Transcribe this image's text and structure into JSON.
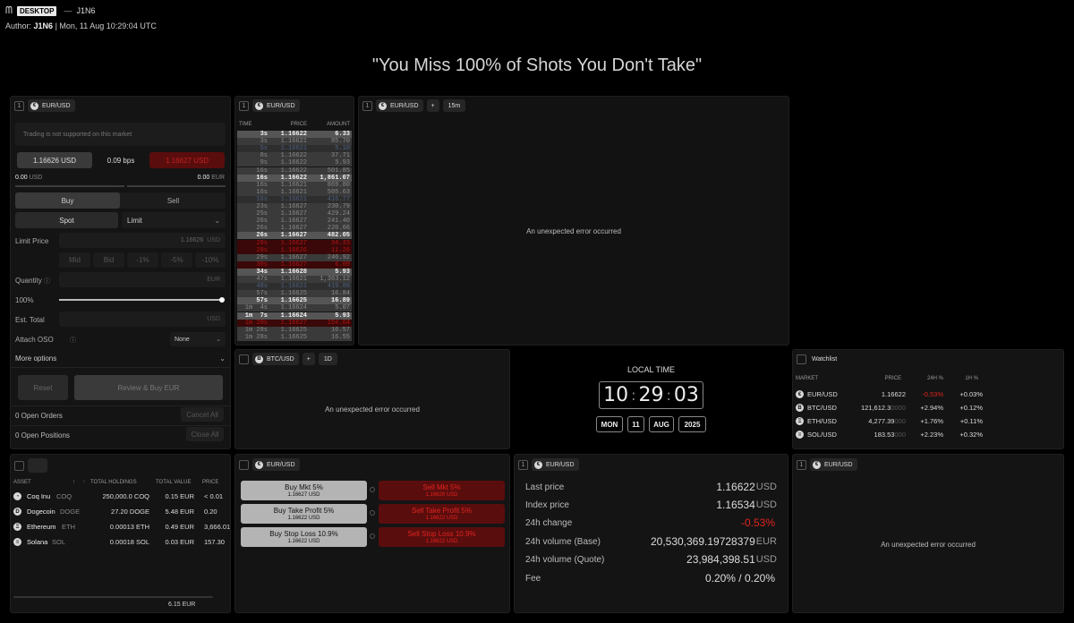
{
  "header": {
    "logo_text": "DESKTOP",
    "dash": "—",
    "title": "J1N6",
    "author_label": "Author:",
    "author": "J1N6",
    "date": "| Mon, 11 Aug 10:29:04 UTC",
    "quote": "\"You Miss 100% of Shots You Don't Take\""
  },
  "trade": {
    "num": "1",
    "market": "EUR/USD",
    "notice": "Trading is not supported on this market",
    "bid": "1.16626 USD",
    "spread": "0.09 bps",
    "ask": "1.16627 USD",
    "bal_left_val": "0.00",
    "bal_left_unit": "USD",
    "bal_right_val": "0.00",
    "bal_right_unit": "EUR",
    "buy": "Buy",
    "sell": "Sell",
    "spot": "Spot",
    "order_type": "Limit",
    "limit_price_label": "Limit Price",
    "limit_price_val": "1.16626",
    "limit_price_unit": "USD",
    "q_mid": "Mid",
    "q_bid": "Bid",
    "q_1": "-1%",
    "q_5": "-5%",
    "q_10": "-10%",
    "qty_label": "Quantity",
    "qty_unit": "EUR",
    "pct_label": "100%",
    "slider_pct": 100,
    "est_label": "Est. Total",
    "est_unit": "USD",
    "oso_label": "Attach OSO",
    "oso_val": "None",
    "more": "More options",
    "reset": "Reset",
    "review": "Review & Buy EUR",
    "open_orders": "0 Open Orders",
    "cancel_all": "Cancel All",
    "open_positions": "0 Open Positions",
    "close_all": "Close All"
  },
  "trades": {
    "num": "1",
    "market": "EUR/USD",
    "h_time": "TIME",
    "h_price": "PRICE",
    "h_amount": "AMOUNT",
    "rows": [
      {
        "t": "3s",
        "p": "1.16622",
        "a": "6.33",
        "c": "w"
      },
      {
        "t": "3s",
        "p": "1.16621",
        "a": "85.70",
        "c": "g"
      },
      {
        "t": "5s",
        "p": "1.16621",
        "a": "5.10",
        "c": "b"
      },
      {
        "t": "8s",
        "p": "1.16622",
        "a": "37.71",
        "c": "g"
      },
      {
        "t": "9s",
        "p": "1.16622",
        "a": "5.93",
        "c": "g"
      },
      {
        "t": "16s",
        "p": "1.16622",
        "a": "501.85",
        "c": "g"
      },
      {
        "t": "16s",
        "p": "1.16622",
        "a": "1,861.07",
        "c": "w"
      },
      {
        "t": "16s",
        "p": "1.16621",
        "a": "869.80",
        "c": "g"
      },
      {
        "t": "16s",
        "p": "1.16621",
        "a": "505.63",
        "c": "g"
      },
      {
        "t": "16s",
        "p": "1.16621",
        "a": "416.77",
        "c": "b"
      },
      {
        "t": "23s",
        "p": "1.16627",
        "a": "230.79",
        "c": "g"
      },
      {
        "t": "25s",
        "p": "1.16627",
        "a": "429.24",
        "c": "g"
      },
      {
        "t": "26s",
        "p": "1.16627",
        "a": "241.40",
        "c": "g"
      },
      {
        "t": "26s",
        "p": "1.16627",
        "a": "220.66",
        "c": "g"
      },
      {
        "t": "26s",
        "p": "1.16627",
        "a": "482.05",
        "c": "w"
      },
      {
        "t": "28s",
        "p": "1.16627",
        "a": "34.33",
        "c": "r"
      },
      {
        "t": "28s",
        "p": "1.16626",
        "a": "11.26",
        "c": "r"
      },
      {
        "t": "29s",
        "p": "1.16627",
        "a": "246.92",
        "c": "g"
      },
      {
        "t": "30s",
        "p": "1.16627",
        "a": "6.09",
        "c": "r"
      },
      {
        "t": "34s",
        "p": "1.16628",
        "a": "5.93",
        "c": "w"
      },
      {
        "t": "47s",
        "p": "1.16621",
        "a": "1,363.12",
        "c": "g"
      },
      {
        "t": "48s",
        "p": "1.16621",
        "a": "419.88",
        "c": "b"
      },
      {
        "t": "57s",
        "p": "1.16625",
        "a": "16.84",
        "c": "g"
      },
      {
        "t": "57s",
        "p": "1.16625",
        "a": "16.89",
        "c": "w"
      },
      {
        "t": "1m  4s",
        "p": "1.16624",
        "a": "5.07",
        "c": "g"
      },
      {
        "t": "1m  7s",
        "p": "1.16624",
        "a": "5.93",
        "c": "w"
      },
      {
        "t": "1m 20s",
        "p": "1.16627",
        "a": "154.64",
        "c": "r"
      },
      {
        "t": "1m 28s",
        "p": "1.16625",
        "a": "16.57",
        "c": "g"
      },
      {
        "t": "1m 28s",
        "p": "1.16625",
        "a": "16.55",
        "c": "g"
      }
    ]
  },
  "chart1": {
    "num": "1",
    "market": "EUR/USD",
    "plus": "+",
    "interval": "15m",
    "error": "An unexpected error occurred"
  },
  "chart2": {
    "market": "BTC/USD",
    "plus": "+",
    "interval": "1D",
    "error": "An unexpected error occurred"
  },
  "clock": {
    "label": "LOCAL TIME",
    "hh": "10",
    "mm": "29",
    "ss": "03",
    "day": "MON",
    "date": "11",
    "month": "AUG",
    "year": "2025"
  },
  "watchlist": {
    "title": "Watchlist",
    "h_market": "MARKET",
    "h_price": "PRICE",
    "h_24h": "24H %",
    "h_1h": "1H %",
    "rows": [
      {
        "icon": "€",
        "name": "EUR/USD",
        "price": "1.16622",
        "price_dim": "",
        "d24": "-0.53%",
        "d24c": "neg",
        "d1": "+0.03%"
      },
      {
        "icon": "B",
        "name": "BTC/USD",
        "price": "121,612.3",
        "price_dim": "0000",
        "d24": "+2.94%",
        "d24c": "pos",
        "d1": "+0.12%"
      },
      {
        "icon": "Ξ",
        "name": "ETH/USD",
        "price": "4,277.39",
        "price_dim": "000",
        "d24": "+1.76%",
        "d24c": "pos",
        "d1": "+0.11%"
      },
      {
        "icon": "≡",
        "name": "SOL/USD",
        "price": "183.53",
        "price_dim": "000",
        "d24": "+2.23%",
        "d24c": "pos",
        "d1": "+0.32%"
      }
    ]
  },
  "portfolio": {
    "h_asset": "ASSET",
    "h_holdings": "TOTAL HOLDINGS",
    "h_value": "TOTAL VALUE",
    "h_price": "PRICE",
    "rows": [
      {
        "icon": "◔",
        "name": "Coq Inu",
        "sym": "COQ",
        "hold": "250,000.0 COQ",
        "value": "0.15 EUR",
        "price": "< 0.01"
      },
      {
        "icon": "D",
        "name": "Dogecoin",
        "sym": "DOGE",
        "hold": "27.20 DOGE",
        "value": "5.48 EUR",
        "price": "0.20"
      },
      {
        "icon": "Ξ",
        "name": "Ethereum",
        "sym": "ETH",
        "hold": "0.00013 ETH",
        "value": "0.49 EUR",
        "price": "3,666.01"
      },
      {
        "icon": "≡",
        "name": "Solana",
        "sym": "SOL",
        "hold": "0.00018 SOL",
        "value": "0.03 EUR",
        "price": "157.30"
      }
    ],
    "total": "6.15 EUR"
  },
  "quick": {
    "market": "EUR/USD",
    "buy_mkt": "Buy Mkt 5%",
    "buy_mkt_sub": "1.16627 USD",
    "buy_tp": "Buy Take Profit 5%",
    "buy_tp_sub": "1.16622 USD",
    "buy_sl": "Buy Stop Loss 10.9%",
    "buy_sl_sub": "1.16622 USD",
    "sell_mkt": "Sell Mkt 5%",
    "sell_mkt_sub": "1.16626 USD",
    "sell_tp": "Sell Take Profit 5%",
    "sell_tp_sub": "1.16622 USD",
    "sell_sl": "Sell Stop Loss 10.9%",
    "sell_sl_sub": "1.16622 USD"
  },
  "stats": {
    "num": "1",
    "market": "EUR/USD",
    "last_label": "Last price",
    "last_val": "1.16622",
    "last_unit": "USD",
    "index_label": "Index price",
    "index_val": "1.16534",
    "index_unit": "USD",
    "chg_label": "24h change",
    "chg_val": "-0.53%",
    "volb_label": "24h volume (Base)",
    "volb_val": "20,530,369.19728379",
    "volb_unit": "EUR",
    "volq_label": "24h volume (Quote)",
    "volq_val": "23,984,398.51",
    "volq_unit": "USD",
    "fee_label": "Fee",
    "fee_val": "0.20% / 0.20%"
  },
  "chart3": {
    "num": "1",
    "market": "EUR/USD",
    "error": "An unexpected error occurred"
  },
  "colors": {
    "bg": "#000000",
    "panel": "#141414",
    "negative": "#e0241f",
    "positive": "#d8d8d8",
    "sell_bg": "#5a0d0d"
  }
}
